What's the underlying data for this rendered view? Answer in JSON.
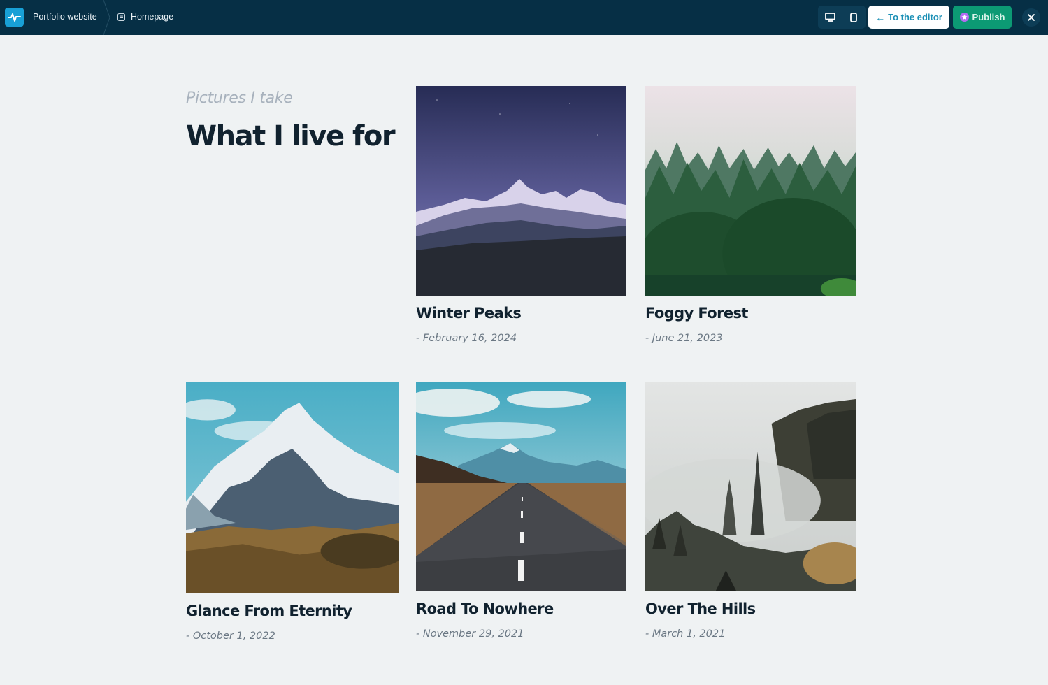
{
  "topbar": {
    "project_name": "Portfolio website",
    "page_name": "Homepage",
    "editor_label": "To the editor",
    "publish_label": "Publish"
  },
  "section": {
    "subtitle": "Pictures I take",
    "heading": "What I live for"
  },
  "gallery": [
    {
      "title": "Winter Peaks",
      "date": "- February 16, 2024"
    },
    {
      "title": "Foggy Forest",
      "date": "- June 21, 2023"
    },
    {
      "title": "Glance From Eternity",
      "date": "- October 1, 2022"
    },
    {
      "title": "Road To Nowhere",
      "date": "- November 29, 2021"
    },
    {
      "title": "Over The Hills",
      "date": "- March 1, 2021"
    }
  ],
  "colors": {
    "topbar_bg": "#062f45",
    "page_bg": "#eff2f3",
    "accent": "#1a8fb5",
    "publish": "#0c9a74"
  }
}
